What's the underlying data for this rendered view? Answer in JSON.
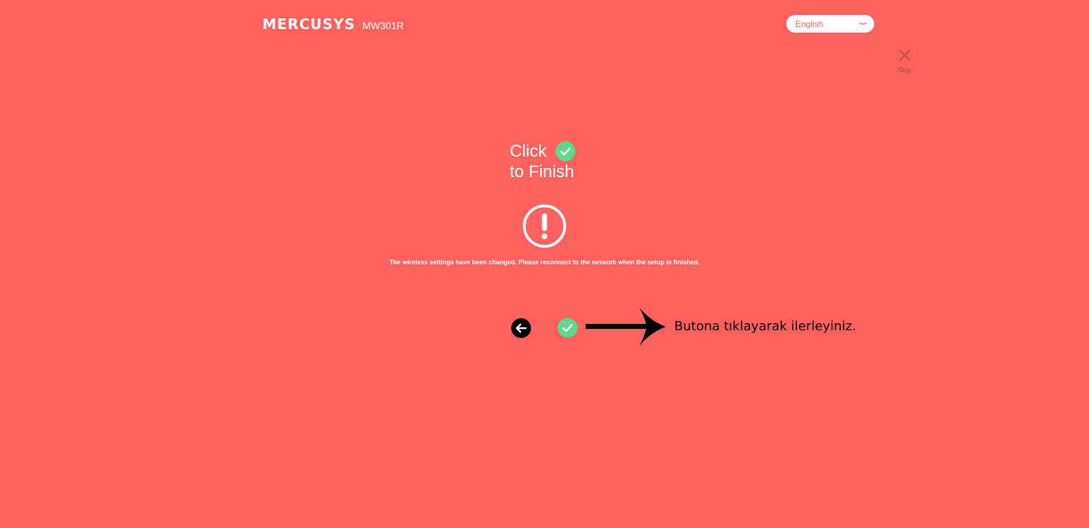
{
  "header": {
    "brand": "MERCUSYS",
    "model": "MW301R"
  },
  "language": {
    "selected": "English"
  },
  "skip": {
    "label": "Skip"
  },
  "main": {
    "title_line1": "Click",
    "title_line2": "to Finish",
    "notice": "The wireless settings have been changed. Please reconnect to the network when the setup is finished."
  },
  "annotation": {
    "text": "Butona tıklayarak ilerleyiniz."
  },
  "icons": {
    "check": "check-circle-icon",
    "warning": "exclamation-circle-icon",
    "back": "arrow-left-circle-icon",
    "close": "close-icon",
    "dropdown": "chevron-down-icon",
    "annotation_arrow": "arrow-right-icon"
  },
  "colors": {
    "background": "#ff615f",
    "check_green": "#5fd88b",
    "back_button": "#000000",
    "skip": "#c0504f"
  }
}
